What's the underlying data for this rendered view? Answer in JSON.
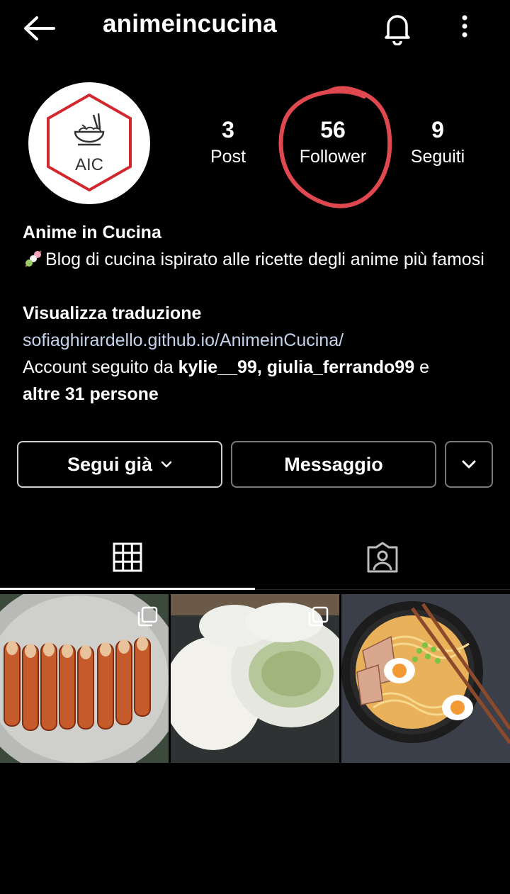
{
  "header": {
    "username": "animeincucina",
    "back_icon": "arrow-left-icon",
    "bell_icon": "bell-icon",
    "more_icon": "more-vertical-icon"
  },
  "profile": {
    "avatar_text": "AIC",
    "stats": {
      "posts_count": "3",
      "posts_label": "Post",
      "followers_count": "56",
      "followers_label": "Follower",
      "following_count": "9",
      "following_label": "Seguiti"
    },
    "highlight_color": "#e0484f"
  },
  "bio": {
    "name": "Anime in Cucina",
    "description": "Blog di cucina ispirato alle ricette degli anime più famosi",
    "translate_label": "Visualizza traduzione",
    "link": "sofiaghirardello.github.io/AnimeinCucina/",
    "followed_prefix": "Account seguito da ",
    "followed_user1": "kylie__99",
    "followed_sep": ", ",
    "followed_user2": "giulia_ferrando99",
    "followed_and": " e",
    "followed_others": "altre 31 persone"
  },
  "actions": {
    "follow_label": "Segui già",
    "message_label": "Messaggio"
  },
  "tabs": {
    "grid_icon": "grid-icon",
    "tagged_icon": "tagged-person-icon"
  },
  "colors": {
    "background": "#000000",
    "link": "#c4d2ea",
    "logo_red": "#d3272f"
  }
}
